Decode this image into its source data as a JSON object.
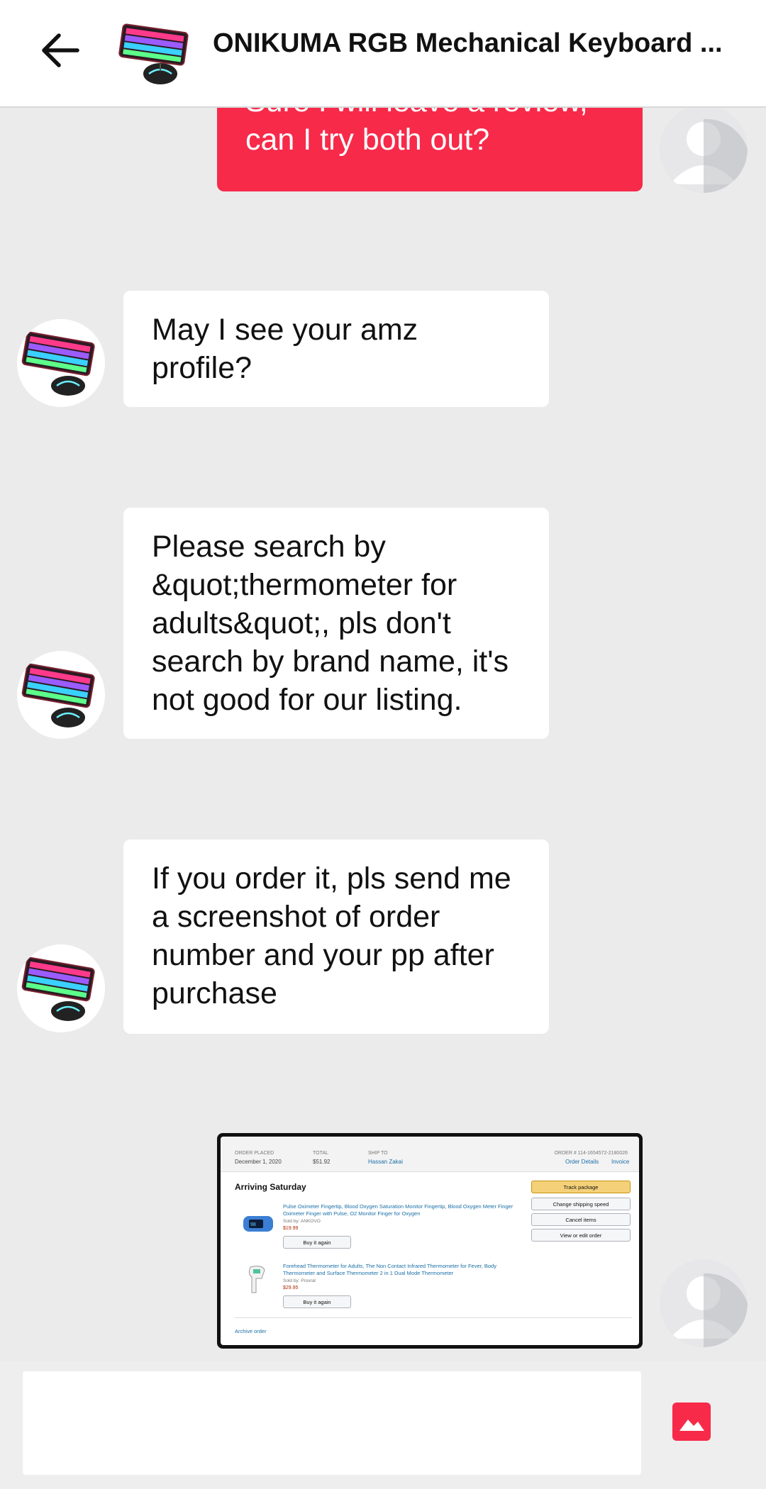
{
  "header": {
    "title": "ONIKUMA RGB Mechanical Keyboard ...",
    "back_icon": "arrow-left-icon",
    "product_thumbnail": "keyboard-mouse-thumbnail"
  },
  "messages": [
    {
      "sender": "user",
      "text": "Sure I will leave a review, can I try both out?"
    },
    {
      "sender": "seller",
      "text": "May I see your amz profile?"
    },
    {
      "sender": "seller",
      "text": "Please search by &quot;thermometer for adults&quot;, pls don't search by brand name, it's not good for our listing."
    },
    {
      "sender": "seller",
      "text": "If you order it, pls send me a screenshot of order number and your pp after purchase"
    },
    {
      "sender": "user",
      "type": "image"
    }
  ],
  "order_screenshot": {
    "order_placed_label": "ORDER PLACED",
    "order_placed_value": "December 1, 2020",
    "total_label": "TOTAL",
    "total_value": "$51.92",
    "ship_to_label": "SHIP TO",
    "ship_to_value": "Hassan Zakai",
    "order_number": "ORDER # 114-1654572-2180026",
    "order_details_link": "Order Details",
    "invoice_link": "Invoice",
    "status_heading": "Arriving Saturday",
    "items": [
      {
        "title": "Pulse Oximeter Fingertip, Blood Oxygen Saturation Monitor Fingertip, Blood Oxygen Meter Finger Oximeter Finger with Pulse, O2 Monitor Finger for Oxygen",
        "sold_by": "Sold by: ANKOVO",
        "price": "$19.99",
        "buy_again": "Buy it again"
      },
      {
        "title": "Forehead Thermometer for Adults, The Non Contact Infrared Thermometer for Fever, Body Thermometer and Surface Thermometer 2 in 1 Dual Mode Thermometer",
        "sold_by": "Sold by: Proxral",
        "price": "$29.95",
        "buy_again": "Buy it again"
      }
    ],
    "actions": [
      "Track package",
      "Change shipping speed",
      "Cancel items",
      "View or edit order"
    ],
    "archive_link": "Archive order"
  },
  "input": {
    "placeholder": "",
    "value": "",
    "image_button_icon": "image-icon"
  },
  "colors": {
    "accent": "#f72a4a",
    "background": "#ebebeb",
    "bubble_in": "#ffffff"
  }
}
